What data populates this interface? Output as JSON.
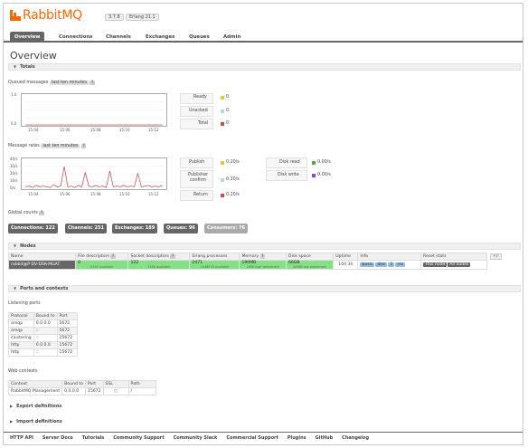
{
  "app": {
    "logo_text": "RabbitMQ",
    "version": "3.7.8",
    "erlang": "Erlang 21.1",
    "logo_color": "#ff6600"
  },
  "nav": {
    "tabs": [
      {
        "label": "Overview",
        "active": true
      },
      {
        "label": "Connections"
      },
      {
        "label": "Channels"
      },
      {
        "label": "Exchanges"
      },
      {
        "label": "Queues"
      },
      {
        "label": "Admin"
      }
    ]
  },
  "page": {
    "title": "Overview"
  },
  "totals": {
    "section": "Totals",
    "queued": {
      "label": "Queued messages",
      "range": "last ten minutes",
      "help": "?",
      "yticks": [
        "1.0",
        "0.0"
      ],
      "xticks": [
        "15:04",
        "15:06",
        "15:08",
        "15:10",
        "15:12"
      ],
      "legend": [
        {
          "label": "Ready",
          "value": "0",
          "color": "#edc240"
        },
        {
          "label": "Unacked",
          "value": "0",
          "color": "#afd8f8"
        },
        {
          "label": "Total",
          "value": "0",
          "color": "#cb4b4b"
        }
      ]
    },
    "rates": {
      "label": "Message rates",
      "range": "last ten minutes",
      "help": "?",
      "yticks": [
        "40/s",
        "30/s",
        "20/s",
        "10/s",
        "0/s"
      ],
      "xticks": [
        "15:04",
        "15:06",
        "15:08",
        "15:10",
        "15:12"
      ],
      "legend": [
        {
          "label": "Publish",
          "value": "0.20/s",
          "color": "#edc240"
        },
        {
          "label": "Publisher confirm",
          "value": "0.20/s",
          "color": "#afd8f8"
        },
        {
          "label": "Return",
          "value": "0.20/s",
          "color": "#cb4b4b"
        }
      ],
      "legend2": [
        {
          "label": "Disk read",
          "value": "0.00/s",
          "color": "#4da74d"
        },
        {
          "label": "Disk write",
          "value": "0.00/s",
          "color": "#9440ed"
        }
      ]
    },
    "global_counts": {
      "label": "Global counts",
      "help": "?",
      "items": [
        "Connections: 122",
        "Channels: 251",
        "Exchanges: 189",
        "Queues: 96",
        "Consumers: 76"
      ]
    }
  },
  "nodes": {
    "section": "Nodes",
    "headers": [
      "Name",
      "File descriptors",
      "Socket descriptors",
      "Erlang processes",
      "Memory",
      "Disk space",
      "Uptime",
      "Info",
      "Reset stats"
    ],
    "help": "?",
    "plusminus": "+/-",
    "row": {
      "name": "rabbit@P-DV-DSK-MGAT",
      "fd": "0",
      "fd_sub": "8192 available",
      "sd": "122",
      "sd_sub": "7280 available",
      "ep": "2471",
      "ep_sub": "1048576 available",
      "mem": "190MB",
      "mem_sub": "1MiB high watermark",
      "disk": "66GB",
      "disk_sub": "48MiB low watermark",
      "uptime": "10d 3h",
      "info": [
        "basic",
        "disc",
        "1",
        "rss"
      ],
      "reset": [
        "This node",
        "All nodes"
      ]
    }
  },
  "ports": {
    "section": "Ports and contexts",
    "listening_label": "Listening ports",
    "headers": [
      "Protocol",
      "Bound to",
      "Port"
    ],
    "rows": [
      [
        "amqp",
        "0.0.0.0",
        "5672"
      ],
      [
        "amqp",
        "::",
        "5672"
      ],
      [
        "clustering",
        "::",
        "25672"
      ],
      [
        "http",
        "0.0.0.0",
        "15672"
      ],
      [
        "http",
        "::",
        "15672"
      ]
    ],
    "web_label": "Web contexts",
    "web_headers": [
      "Context",
      "Bound to",
      "Port",
      "SSL",
      "Path"
    ],
    "web_rows": [
      [
        "RabbitMQ Management",
        "0.0.0.0",
        "15672",
        "○",
        "/"
      ]
    ]
  },
  "collapsed": [
    "Export definitions",
    "Import definitions"
  ],
  "footer": [
    "HTTP API",
    "Server Docs",
    "Tutorials",
    "Community Support",
    "Community Slack",
    "Commercial Support",
    "Plugins",
    "GitHub",
    "Changelog"
  ],
  "chart_data": [
    {
      "type": "line",
      "title": "Queued messages",
      "x": [
        "15:04",
        "15:06",
        "15:08",
        "15:10",
        "15:12"
      ],
      "ylim": [
        0,
        1
      ],
      "series": [
        {
          "name": "Total",
          "values": [
            0,
            0,
            0,
            0,
            0
          ]
        }
      ]
    },
    {
      "type": "line",
      "title": "Message rates",
      "ylim": [
        0,
        40
      ],
      "x": [
        "15:04",
        "15:06",
        "15:08",
        "15:10",
        "15:12"
      ],
      "series": [
        {
          "name": "Return",
          "values": [
            2,
            3,
            1,
            4,
            2,
            3,
            2,
            1,
            5,
            2,
            3,
            30,
            2,
            3,
            1,
            4,
            2,
            22,
            3,
            2,
            4,
            2,
            3,
            1,
            24,
            2,
            3,
            2,
            4,
            2,
            3,
            2,
            21,
            2,
            3,
            4,
            2,
            3,
            2,
            4
          ]
        }
      ]
    }
  ]
}
